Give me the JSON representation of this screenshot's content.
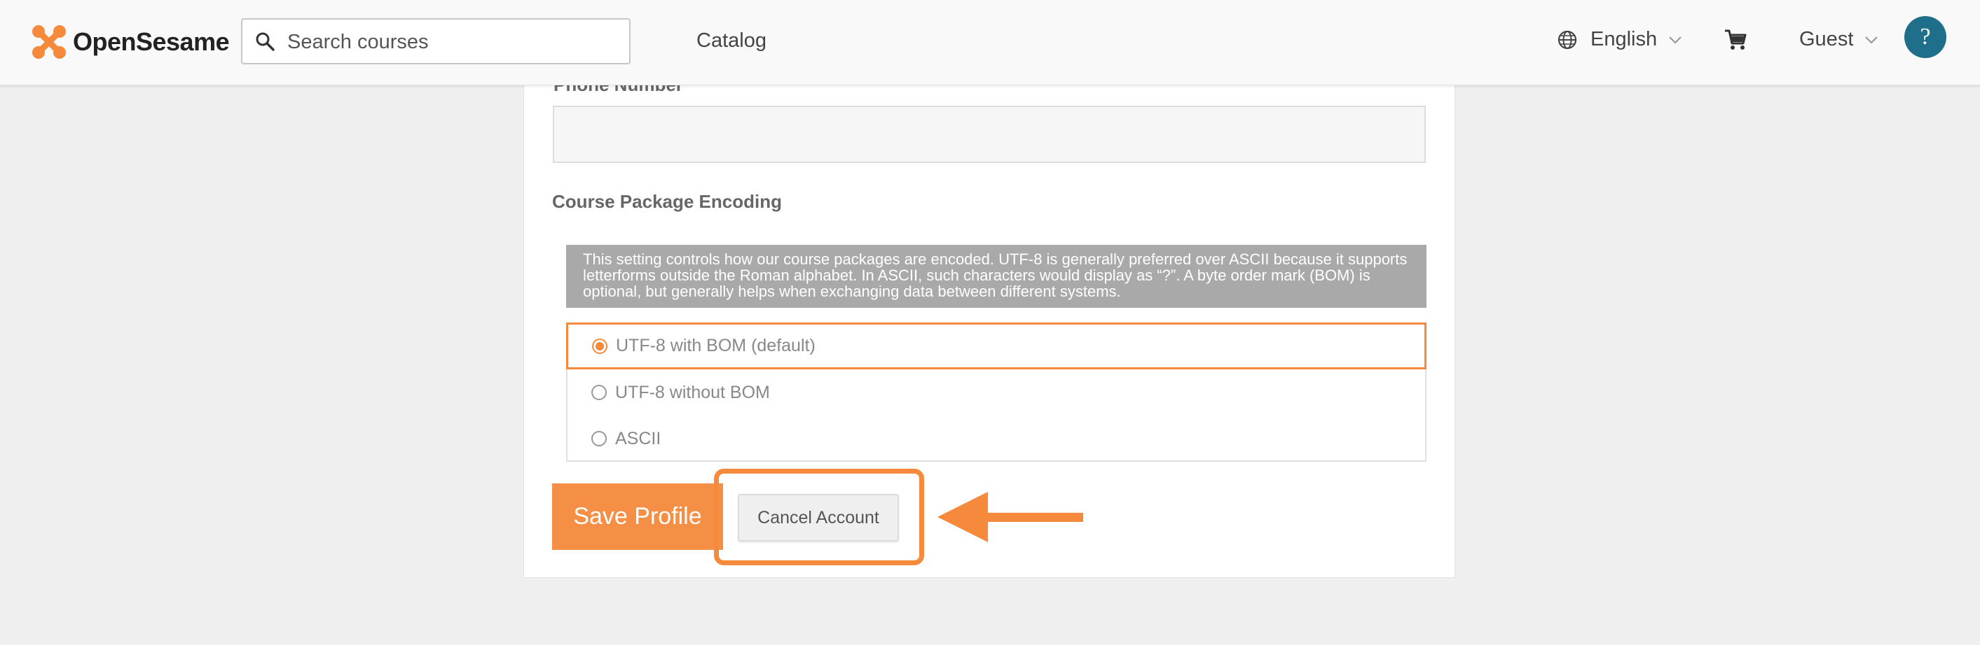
{
  "header": {
    "logo_text": "OpenSesame",
    "search_placeholder": "Search courses",
    "nav": {
      "catalog": "Catalog"
    },
    "language": "English",
    "user": "Guest",
    "help": "?"
  },
  "icons": {
    "logo": "opensesame-logo",
    "search": "search-icon",
    "globe": "globe-icon",
    "cart": "cart-icon",
    "chevron": "chevron-down-icon"
  },
  "form": {
    "phone_label": "Phone Number",
    "phone_value": "",
    "encoding_label": "Course Package Encoding",
    "encoding_info": "This setting controls how our course packages are encoded. UTF-8 is generally preferred over ASCII because it supports letterforms outside the Roman alphabet. In ASCII, such characters would display as “?”. A byte order mark (BOM) is optional, but generally helps when exchanging data between different systems.",
    "options": [
      {
        "label": "UTF-8 with BOM (default)",
        "selected": true
      },
      {
        "label": "UTF-8 without BOM",
        "selected": false
      },
      {
        "label": "ASCII",
        "selected": false
      }
    ],
    "save_label": "Save Profile",
    "cancel_label": "Cancel Account"
  },
  "colors": {
    "accent": "#f58a3c",
    "help_button": "#1f6f8b",
    "info_box": "#a9a9a9"
  }
}
